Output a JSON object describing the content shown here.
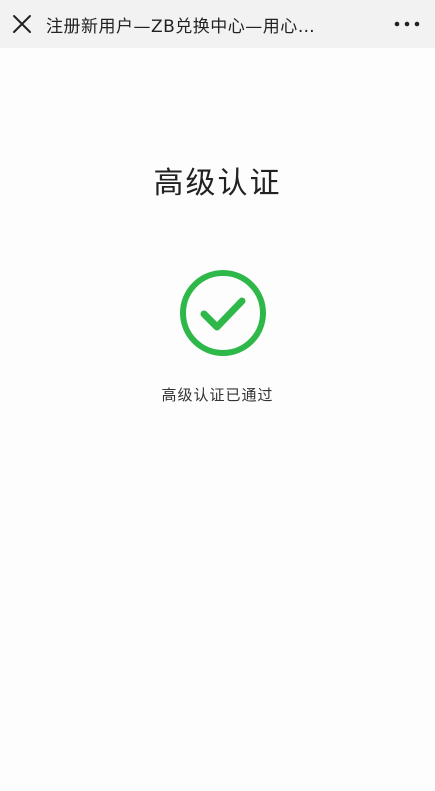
{
  "header": {
    "title": "注册新用户—ZB兑换中心—用心…",
    "close_icon": "close-icon",
    "more_icon": "more-horizontal-icon"
  },
  "main": {
    "heading": "高级认证",
    "status_icon": "check-circle-icon",
    "status_text": "高级认证已通过"
  },
  "colors": {
    "accent_green": "#2fb84a",
    "header_background": "#f2f2f2"
  }
}
